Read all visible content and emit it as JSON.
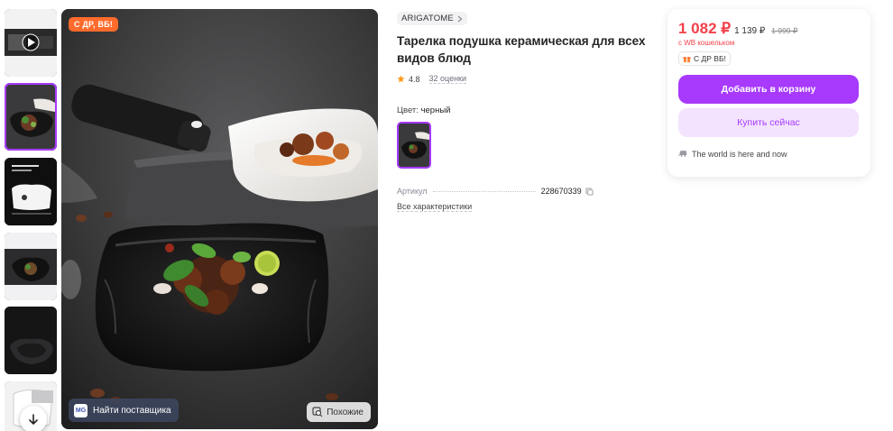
{
  "gallery": {
    "thumbnails": [
      {
        "name": "thumb-video",
        "active": false
      },
      {
        "name": "thumb-plate-1",
        "active": true
      },
      {
        "name": "thumb-dimensions",
        "active": false
      },
      {
        "name": "thumb-plate-2",
        "active": false
      },
      {
        "name": "thumb-plate-3",
        "active": false
      },
      {
        "name": "thumb-plate-white",
        "active": false
      }
    ],
    "promo_badge": "С ДР, ВБ!",
    "supplier_logo": "MG",
    "supplier_label": "Найти поставщика",
    "similar_label": "Похожие",
    "icons": [
      "play-icon",
      "arrow-down-icon",
      "similar-icon"
    ]
  },
  "product": {
    "brand": "ARIGATOME",
    "title": "Тарелка подушка керамическая для всех видов блюд",
    "rating": "4.8",
    "reviews": "32 оценки",
    "color_label": "Цвет:",
    "color_value": "черный",
    "article_label": "Артикул",
    "article_value": "228670339",
    "all_specs": "Все характеристики"
  },
  "price_card": {
    "price": "1 082 ₽",
    "price_without_wallet": "1 139 ₽",
    "price_old": "1 999 ₽",
    "wallet_note": "с WB кошельком",
    "badge": "С ДР ВБ!",
    "add_to_cart": "Добавить в корзину",
    "buy_now": "Купить сейчас",
    "seller_tagline": "The world is here and now"
  },
  "colors": {
    "accent": "#a73afd",
    "price": "#f2414a",
    "badge_orange": "#ff6b2c"
  }
}
